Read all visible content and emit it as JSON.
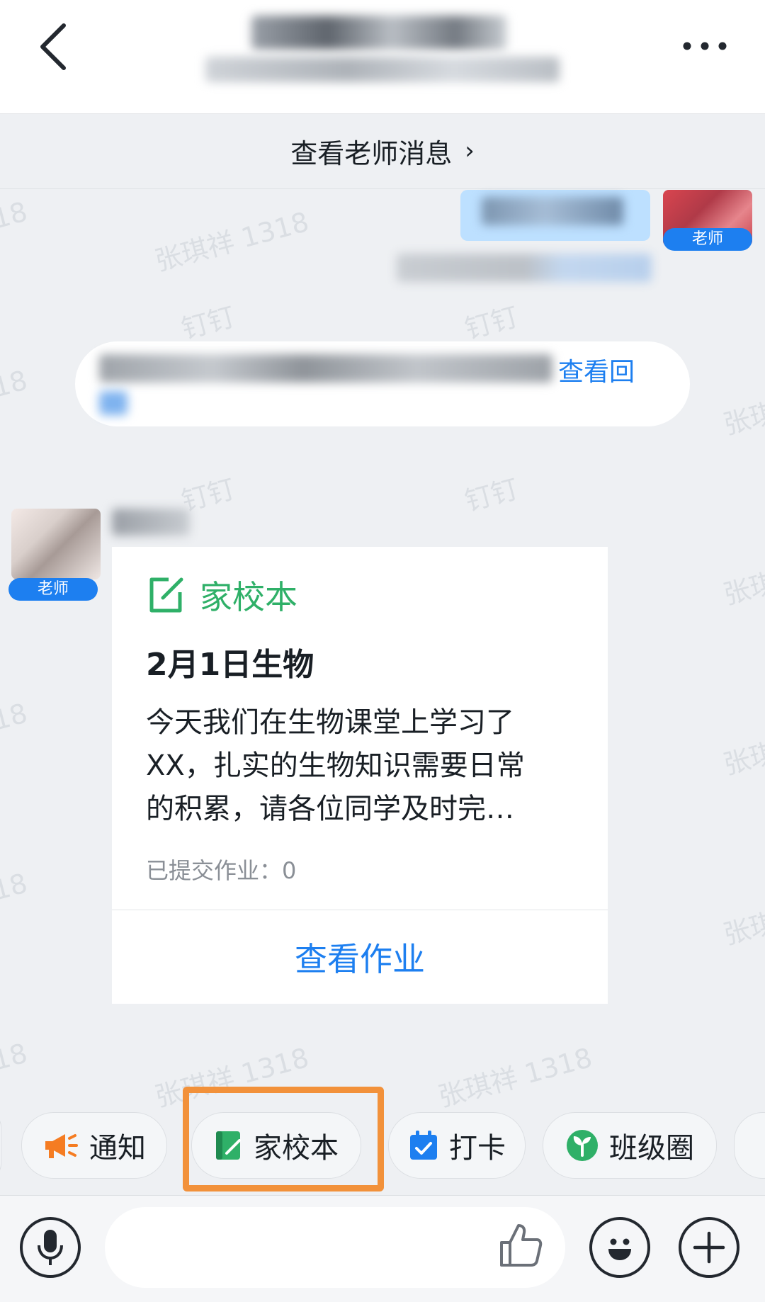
{
  "header": {
    "back_icon": "chevron-left-icon",
    "more_icon": "more-dots-icon"
  },
  "teacher_link": {
    "label": "查看老师消息",
    "chevron": "›"
  },
  "watermark": {
    "name_text": "张琪祥 1318",
    "app_text": "钉钉",
    "partial_num": "18",
    "partial_name": "张琪"
  },
  "messages": {
    "teacher_tag": "老师",
    "system_link": "查看回"
  },
  "card": {
    "type_label": "家校本",
    "title": "2月1日生物",
    "body_lines": [
      "今天我们在生物课堂上学习了",
      "XX，扎实的生物知识需要日常",
      "的积累，请各位同学及时完…"
    ],
    "submitted": "已提交作业：0",
    "action_label": "查看作业"
  },
  "quick_bar": {
    "items": [
      {
        "label": "通知",
        "icon": "megaphone-icon",
        "color": "#f57c22"
      },
      {
        "label": "家校本",
        "icon": "notebook-icon",
        "color": "#2fb068"
      },
      {
        "label": "打卡",
        "icon": "calendar-check-icon",
        "color": "#1d7ff0"
      },
      {
        "label": "班级圈",
        "icon": "sprout-icon",
        "color": "#2fb068"
      }
    ],
    "highlight_color": "#f2913a"
  },
  "input_bar": {
    "voice_icon": "microphone-icon",
    "like_icon": "thumbs-up-icon",
    "emoji_icon": "emoji-icon",
    "add_icon": "plus-icon"
  },
  "colors": {
    "accent_blue": "#1d7ff0",
    "brand_green": "#2fb068",
    "background": "#eef0f3"
  }
}
